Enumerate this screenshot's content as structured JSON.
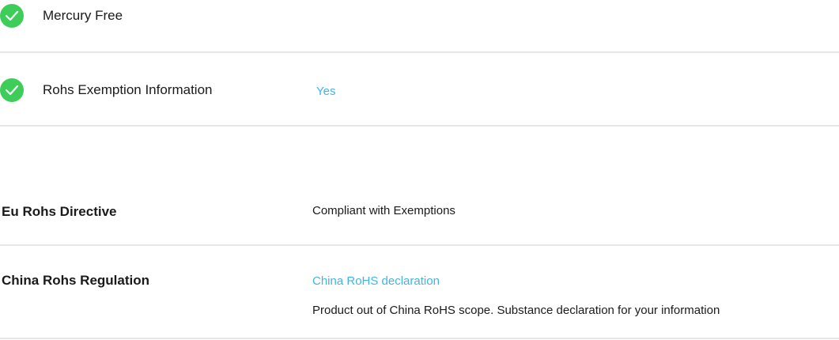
{
  "features": [
    {
      "label": "Mercury Free",
      "value": "",
      "icon": "check-circle-icon",
      "icon_color": "#3dcd58"
    },
    {
      "label": "Rohs Exemption Information",
      "value": "Yes",
      "icon": "check-circle-icon",
      "icon_color": "#3dcd58"
    }
  ],
  "specs": {
    "eu_rohs": {
      "label": "Eu Rohs Directive",
      "value": "Compliant with Exemptions"
    },
    "china_rohs": {
      "label": "China Rohs Regulation",
      "link_text": "China RoHS declaration",
      "note": "Product out of China RoHS scope. Substance declaration for your information"
    }
  },
  "colors": {
    "accent_link": "#42b4e6",
    "check_green": "#3dcd58",
    "divider": "#e6e6e6"
  }
}
